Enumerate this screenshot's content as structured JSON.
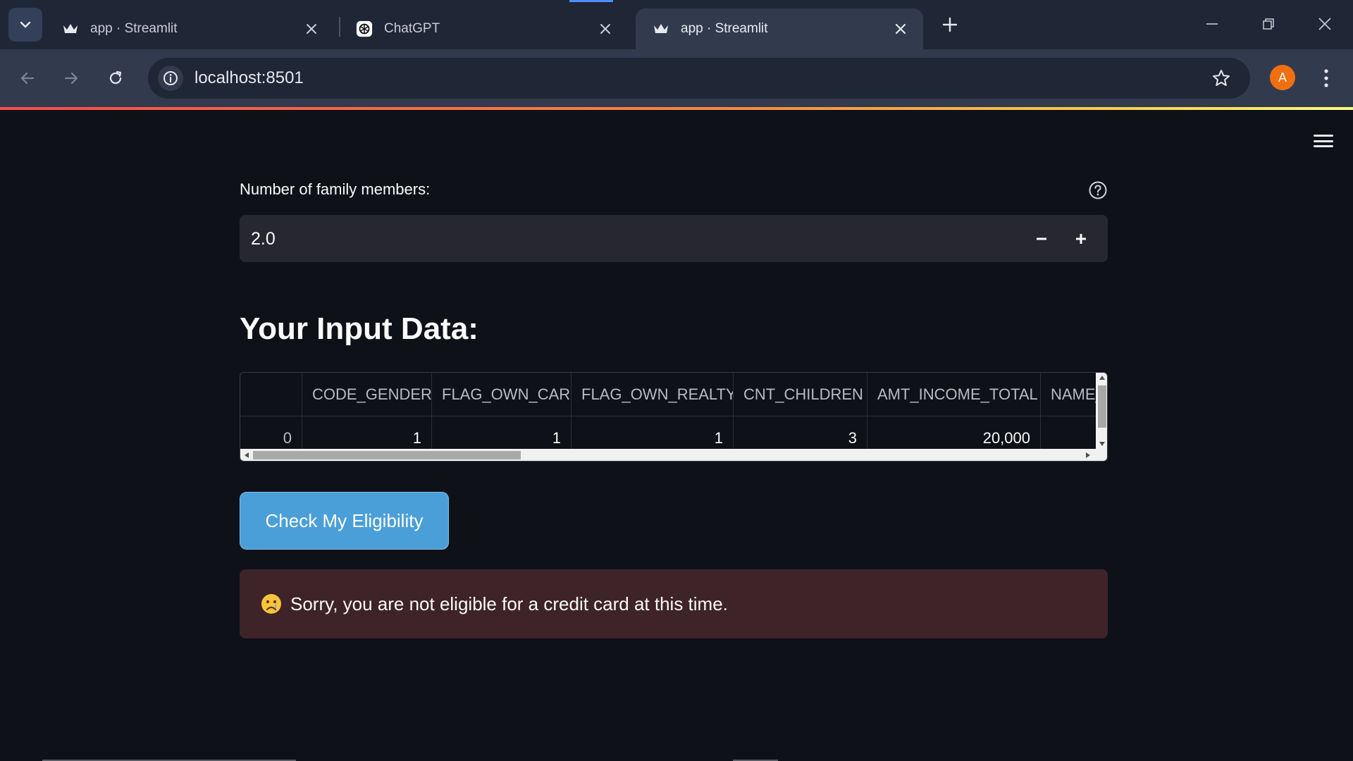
{
  "browser": {
    "tabs": [
      {
        "title": "app · Streamlit",
        "favicon": "streamlit-crown-icon"
      },
      {
        "title": "ChatGPT",
        "favicon": "chatgpt-icon"
      },
      {
        "title": "app · Streamlit",
        "favicon": "streamlit-crown-icon"
      }
    ],
    "active_tab_index": 2,
    "address": "localhost:8501",
    "profile_initial": "A",
    "colors": {
      "profile": "#f0700f",
      "chrome_dark": "#1f2636",
      "chrome": "#323b4e"
    }
  },
  "form": {
    "family_members_label": "Number of family members:",
    "family_members_value": "2.0"
  },
  "input_section": {
    "heading": "Your Input Data:",
    "table": {
      "columns": [
        "",
        "CODE_GENDER",
        "FLAG_OWN_CAR",
        "FLAG_OWN_REALTY",
        "CNT_CHILDREN",
        "AMT_INCOME_TOTAL",
        "NAME_"
      ],
      "rows": [
        [
          "0",
          "1",
          "1",
          "1",
          "3",
          "20,000",
          ""
        ]
      ]
    }
  },
  "action": {
    "check_button_label": "Check My Eligibility"
  },
  "result": {
    "message": "Sorry, you are not eligible for a credit card at this time.",
    "emoji": "crying-face-icon",
    "colors": {
      "background": "#3e2328",
      "button": "#4a9fd8"
    }
  }
}
